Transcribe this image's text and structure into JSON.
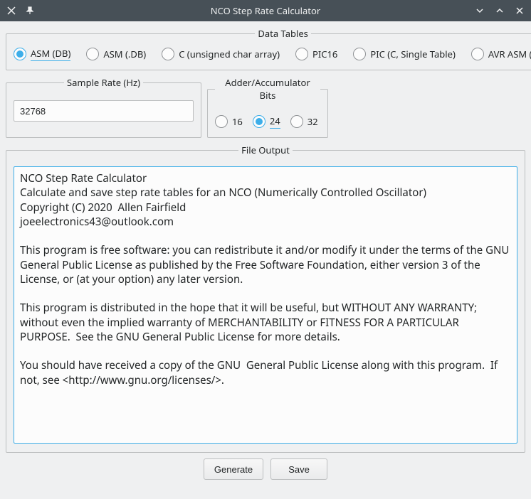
{
  "window": {
    "title": "NCO Step Rate Calculator"
  },
  "tables": {
    "legend": "Data Tables",
    "options": {
      "asm_db": "ASM (DB)",
      "asm_dot_db": "ASM (.DB)",
      "c_uchar": "C (unsigned char array)",
      "pic16": "PIC16",
      "pic_c_single": "PIC (C, Single Table)",
      "avr_asm_dw": "AVR ASM (.DW)"
    },
    "selected": "asm_db"
  },
  "sample": {
    "legend": "Sample Rate (Hz)",
    "value": "32768"
  },
  "bits": {
    "legend": "Adder/Accumulator Bits",
    "options": {
      "b16": "16",
      "b24": "24",
      "b32": "32"
    },
    "selected": "b24"
  },
  "output": {
    "legend": "File Output",
    "text": "NCO Step Rate Calculator\nCalculate and save step rate tables for an NCO (Numerically Controlled Oscillator)\nCopyright (C) 2020  Allen Fairfield\njoeelectronics43@outlook.com\n\nThis program is free software: you can redistribute it and/or modify it under the terms of the GNU General Public License as published by the Free Software Foundation, either version 3 of the License, or (at your option) any later version.\n\nThis program is distributed in the hope that it will be useful, but WITHOUT ANY WARRANTY; without even the implied warranty of MERCHANTABILITY or FITNESS FOR A PARTICULAR PURPOSE.  See the GNU General Public License for more details.\n\nYou should have received a copy of the GNU  General Public License along with this program.  If not, see <http://www.gnu.org/licenses/>."
  },
  "buttons": {
    "generate": "Generate",
    "save": "Save"
  }
}
